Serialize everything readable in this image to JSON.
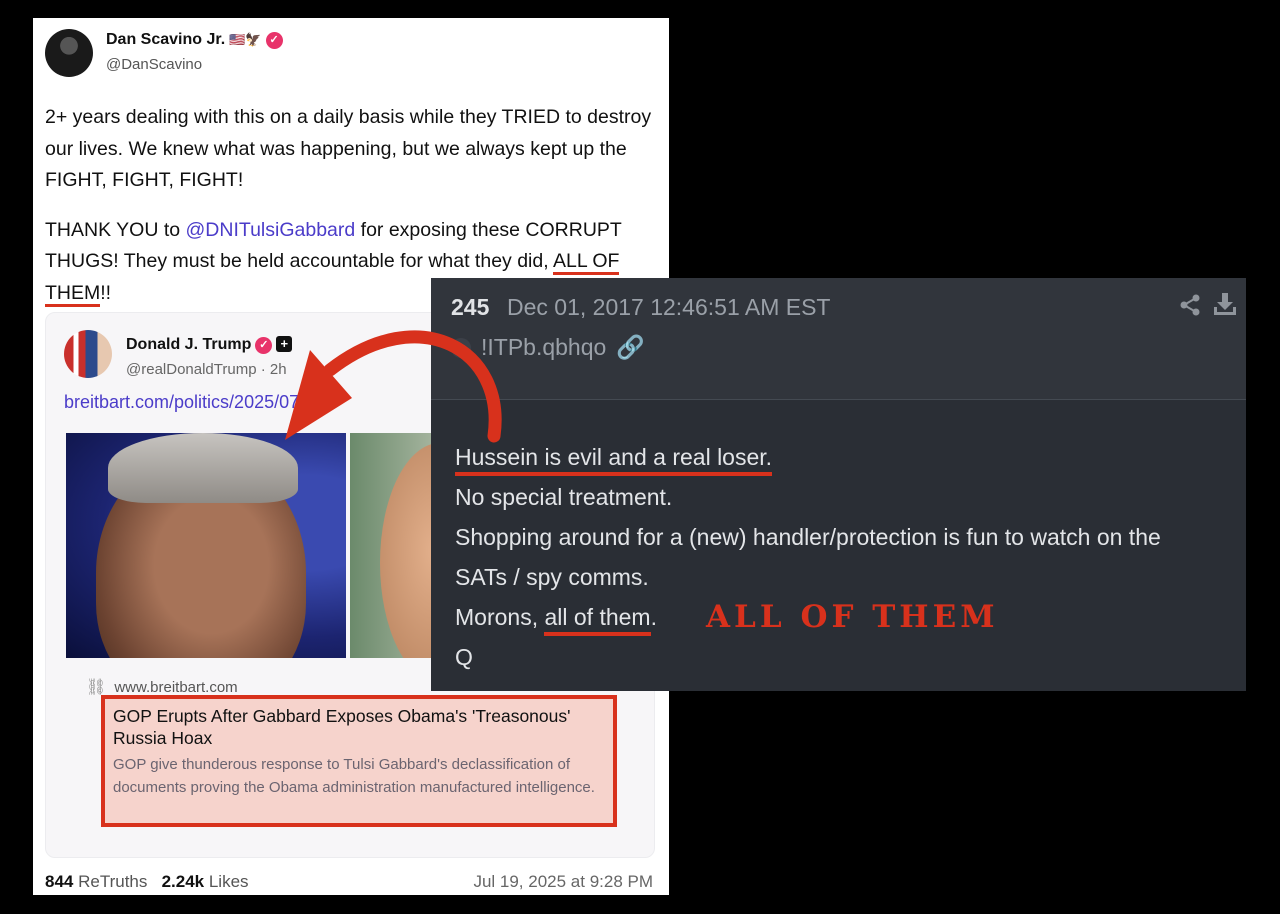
{
  "truth_post": {
    "author_name": "Dan Scavino Jr.",
    "author_flags": "🇺🇸🦅",
    "author_handle": "@DanScavino",
    "paragraph_1": "2+ years dealing with this on a daily basis while they TRIED to destroy our lives. We knew what was happening, but we always kept up the FIGHT, FIGHT, FIGHT!",
    "p2_before": "THANK YOU to ",
    "p2_mention": "@DNITulsiGabbard",
    "p2_middle": " for exposing these CORRUPT THUGS! They must be held accountable for what they did, ",
    "p2_underlined": "ALL OF THEM",
    "p2_after": "!!",
    "retruths_count": "844",
    "retruths_label": "ReTruths",
    "likes_count": "2.24k",
    "likes_label": "Likes",
    "post_date": "Jul 19, 2025 at 9:28 PM"
  },
  "quoted_post": {
    "author_name": "Donald J. Trump",
    "author_handle": "@realDonaldTrump · 2h",
    "link_text": "breitbart.com/politics/2025/07...",
    "link_domain": "www.breitbart.com",
    "article_title": "GOP Erupts After Gabbard Exposes Obama's 'Treasonous' Russia Hoax",
    "article_description": "GOP give thunderous response to Tulsi Gabbard's declassification of documents proving the Obama administration manufactured intelligence."
  },
  "q_post": {
    "number": "245",
    "date": "Dec 01, 2017 12:46:51 AM EST",
    "tripcode": "!ITPb.qbhqo",
    "line_1": "Hussein is evil and a real loser.",
    "line_2": "No special treatment.",
    "line_3": "Shopping around for a (new) handler/protection is fun to watch on the",
    "line_4": "SATs / spy comms.",
    "line_5_before": "Morons, ",
    "line_5_underlined": "all of them",
    "line_5_after": ".",
    "line_6": "Q",
    "annotation": "ALL OF THEM"
  },
  "icons": {
    "verified": "✓",
    "plus": "+",
    "link": "🔗",
    "share": "share-icon",
    "download": "download-icon"
  },
  "colors": {
    "annotation_red": "#d8311c",
    "mention_purple": "#4b3cc9",
    "q_panel_bg": "#2a2e35",
    "verified_pink": "#e8336a"
  }
}
